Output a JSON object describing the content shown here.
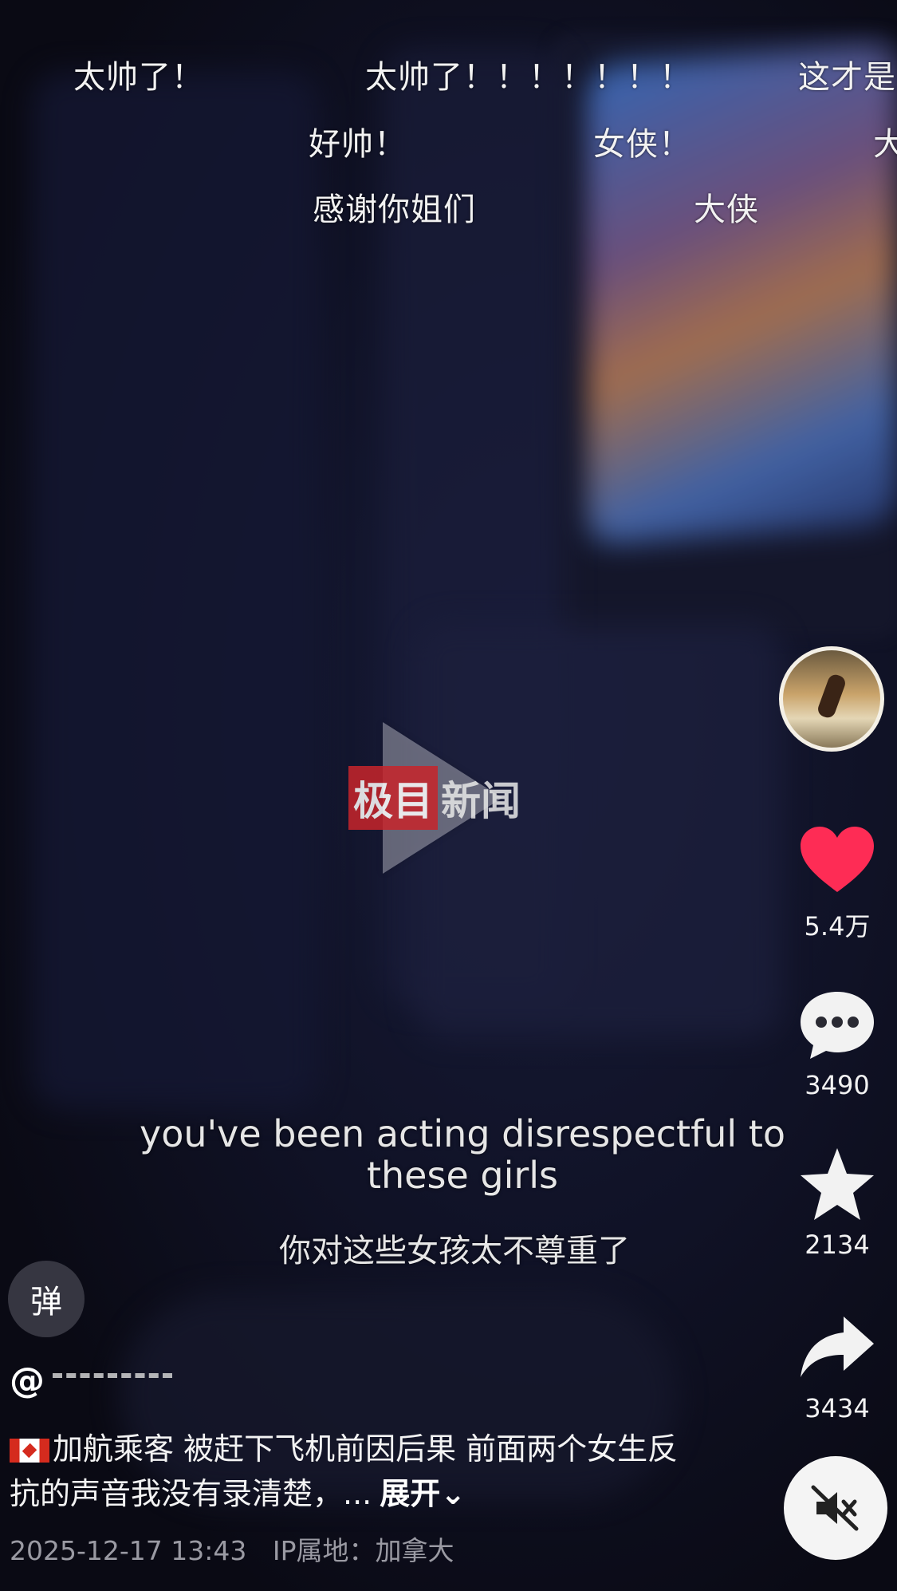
{
  "danmaku": [
    {
      "text": "太帅了！"
    },
    {
      "text": "太帅了！！！！！！！"
    },
    {
      "text": "这才是"
    },
    {
      "text": "好帅！"
    },
    {
      "text": "女侠！"
    },
    {
      "text": "大"
    },
    {
      "text": "感谢你姐们"
    },
    {
      "text": "大侠"
    }
  ],
  "watermark": {
    "red_part": "极目",
    "white_part": "新闻"
  },
  "subtitles": {
    "english": "you've been acting disrespectful to these girls",
    "chinese": "你对这些女孩太不尊重了"
  },
  "actions": {
    "like_count": "5.4万",
    "comment_count": "3490",
    "favorite_count": "2134",
    "share_count": "3434"
  },
  "danmu_toggle_label": "弹",
  "author_prefix": "@",
  "caption": {
    "text": "加航乘客 被赶下飞机前因后果 前面两个女生反抗的声音我没有录清楚，...",
    "expand_label": "展开⌄"
  },
  "meta": {
    "timestamp": "2025-12-17 13:43",
    "ip_location": "IP属地：加拿大"
  },
  "colors": {
    "like_red": "#fe2c55",
    "watermark_red": "#c7252b",
    "background": "#0b0b13"
  },
  "icons": [
    "heart-icon",
    "comment-icon",
    "star-icon",
    "share-icon",
    "mute-icon",
    "play-icon",
    "canada-flag-icon"
  ]
}
